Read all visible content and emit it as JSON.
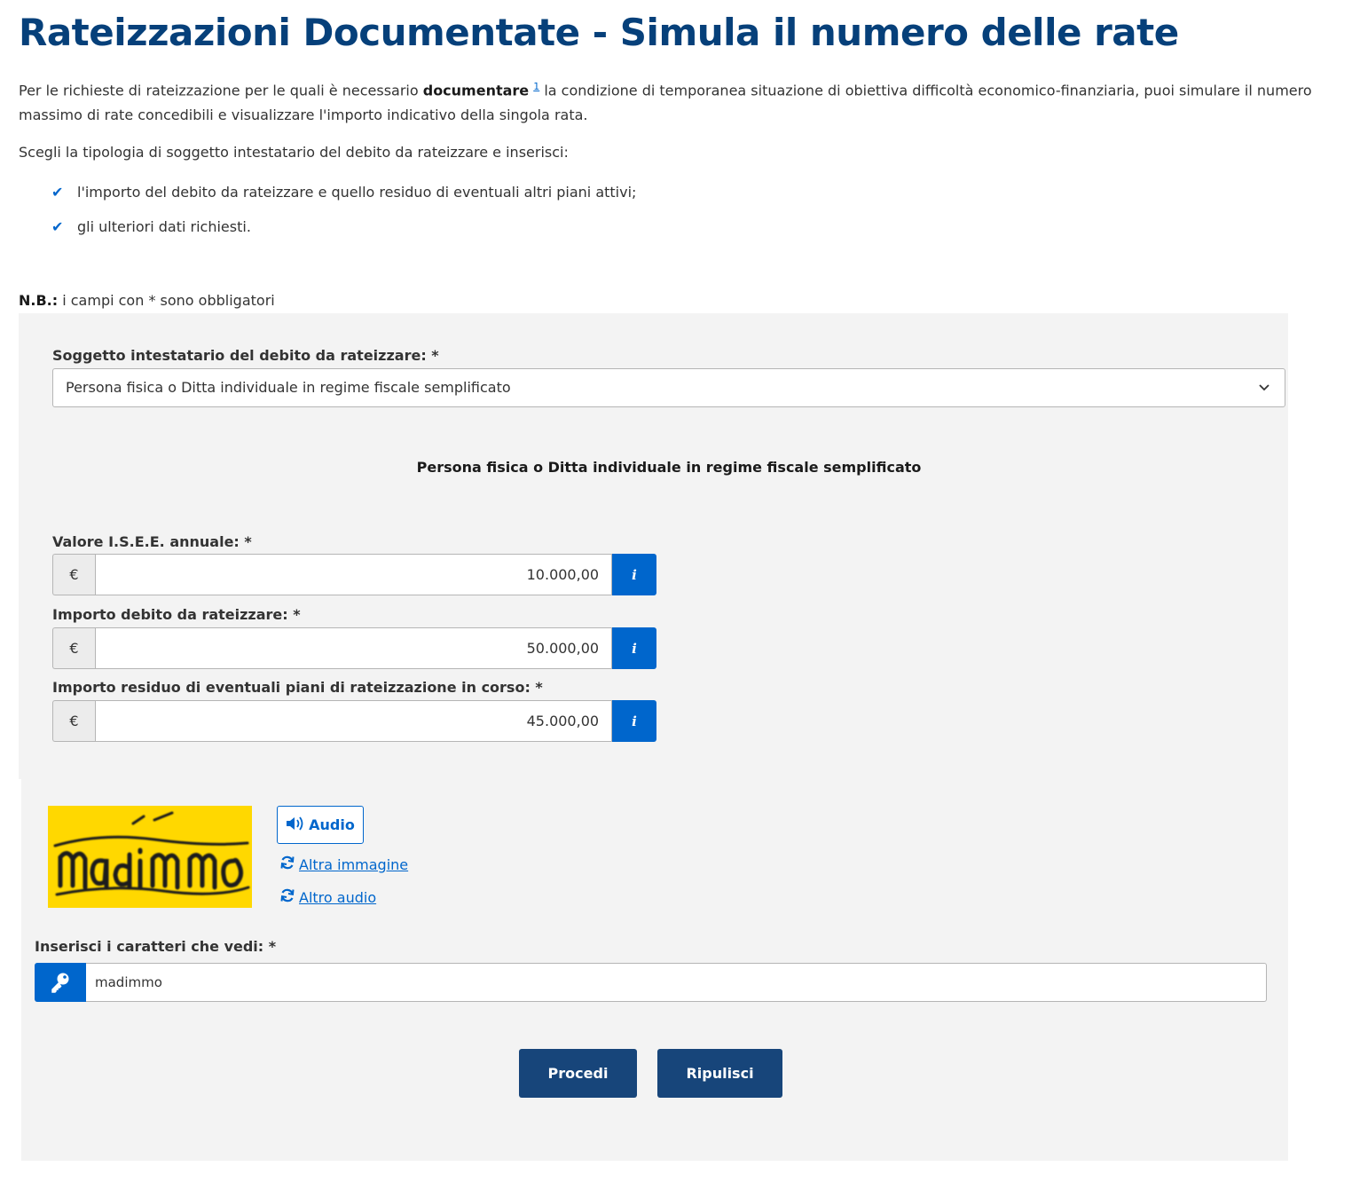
{
  "page": {
    "title": "Rateizzazioni Documentate - Simula il numero delle rate",
    "intro_before": "Per le richieste di rateizzazione per le quali è necessario ",
    "intro_bold": "documentare",
    "intro_sup": "1",
    "intro_after": " la condizione di temporanea situazione di obiettiva difficoltà economico-finanziaria, puoi simulare il numero massimo di rate concedibili e visualizzare l'importo indicativo della singola rata.",
    "instruction": "Scegli la tipologia di soggetto intestatario del debito da rateizzare e inserisci:",
    "checklist": [
      "l'importo del debito da rateizzare e quello residuo di eventuali altri piani attivi;",
      "gli ulteriori dati richiesti."
    ],
    "nb_label": "N.B.:",
    "nb_text": " i campi con * sono obbligatori"
  },
  "form": {
    "subject_label": "Soggetto intestatario del debito da rateizzare: *",
    "subject_value": "Persona fisica o Ditta individuale in regime fiscale semplificato",
    "section_heading": "Persona fisica o Ditta individuale in regime fiscale semplificato",
    "currency_symbol": "€",
    "info_symbol": "i",
    "fields": [
      {
        "label": "Valore I.S.E.E. annuale: *",
        "value": "10.000,00"
      },
      {
        "label": "Importo debito da rateizzare: *",
        "value": "50.000,00"
      },
      {
        "label": "Importo residuo di eventuali piani di rateizzazione in corso: *",
        "value": "45.000,00"
      }
    ]
  },
  "captcha": {
    "audio_label": "Audio",
    "other_image_label": "Altra immagine",
    "other_audio_label": "Altro audio",
    "input_label": "Inserisci i caratteri che vedi: *",
    "input_value": "madimmo"
  },
  "actions": {
    "proceed_label": "Procedi",
    "clear_label": "Ripulisci"
  },
  "colors": {
    "title": "#06407a",
    "accent": "#0066cc",
    "button": "#17457a",
    "panel": "#f3f3f3",
    "captcha_bg": "#ffd800"
  },
  "icons": [
    "checkmark-icon",
    "chevron-down-icon",
    "info-icon",
    "speaker-icon",
    "refresh-icon",
    "key-icon"
  ]
}
